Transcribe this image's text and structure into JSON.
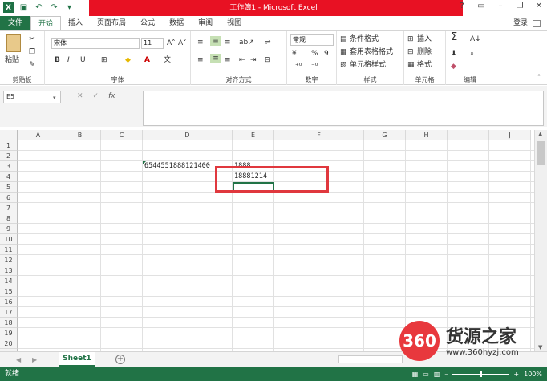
{
  "window": {
    "title": "工作簿1 - Microsoft Excel",
    "login": "登录"
  },
  "ribbon_tabs": [
    "文件",
    "开始",
    "插入",
    "页面布局",
    "公式",
    "数据",
    "审阅",
    "视图"
  ],
  "ribbon": {
    "clipboard": {
      "paste": "粘贴",
      "label": "剪贴板"
    },
    "font": {
      "name": "宋体",
      "size": "11",
      "label": "字体",
      "bold": "B",
      "italic": "I",
      "underline": "U"
    },
    "alignment": {
      "label": "对齐方式"
    },
    "number": {
      "format": "常规",
      "percent": "%",
      "comma": "9",
      "label": "数字"
    },
    "styles": {
      "conditional": "条件格式",
      "table": "套用表格格式",
      "cell": "单元格样式",
      "label": "样式"
    },
    "cells": {
      "insert": "插入",
      "delete": "删除",
      "format": "格式",
      "label": "单元格"
    },
    "editing": {
      "label": "编辑"
    }
  },
  "formula_bar": {
    "name_box": "E5",
    "formula": ""
  },
  "grid": {
    "columns": [
      "A",
      "B",
      "C",
      "D",
      "E",
      "F",
      "G",
      "H",
      "I",
      "J"
    ],
    "rows": [
      "1",
      "2",
      "3",
      "4",
      "5",
      "6",
      "7",
      "8",
      "9",
      "10",
      "11",
      "12",
      "13",
      "14",
      "15",
      "16",
      "17",
      "18",
      "19",
      "20",
      "21"
    ],
    "cells": {
      "D3": "6544551888121400",
      "E3": "1888",
      "E4": "18881214"
    }
  },
  "sheets": {
    "active": "Sheet1"
  },
  "status": {
    "ready": "就绪",
    "zoom": "100%"
  },
  "watermark": {
    "logo": "360",
    "brand": "货源之家",
    "url": "www.360hyzj.com"
  },
  "colors": {
    "excel_green": "#217346",
    "title_red": "#e81123",
    "highlight_red": "#e0383e"
  }
}
